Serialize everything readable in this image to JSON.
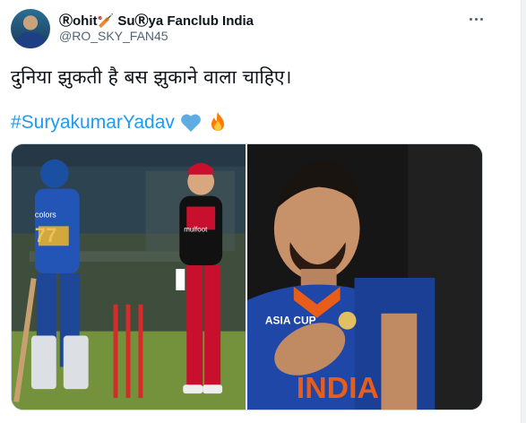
{
  "tweet": {
    "display_name": "Ⓡohit🏏 SuⓇya Fanclub India",
    "handle": "@RO_SKY_FAN45",
    "text": "दुनिया झुकती है बस झुकाने वाला चाहिए।",
    "hashtag": "#SuryakumarYadav",
    "emojis": [
      "blue-heart-icon",
      "fire-icon"
    ],
    "more_icon": "more-horizontal-icon"
  },
  "media": {
    "photos": [
      {
        "id": "left",
        "description_icon": "cricket-match-photo",
        "jersey_number": "77",
        "jersey_text": "mulfoot",
        "brand_text": "colors"
      },
      {
        "id": "right",
        "description_icon": "cricket-player-photo",
        "jersey_text": "INDIA",
        "sponsor_text": "ASIA CUP"
      }
    ]
  },
  "colors": {
    "link": "#1d9bf0",
    "text": "#0f1419",
    "secondary": "#536471",
    "heart": "#5dade2",
    "fire": "#ff7a00"
  }
}
